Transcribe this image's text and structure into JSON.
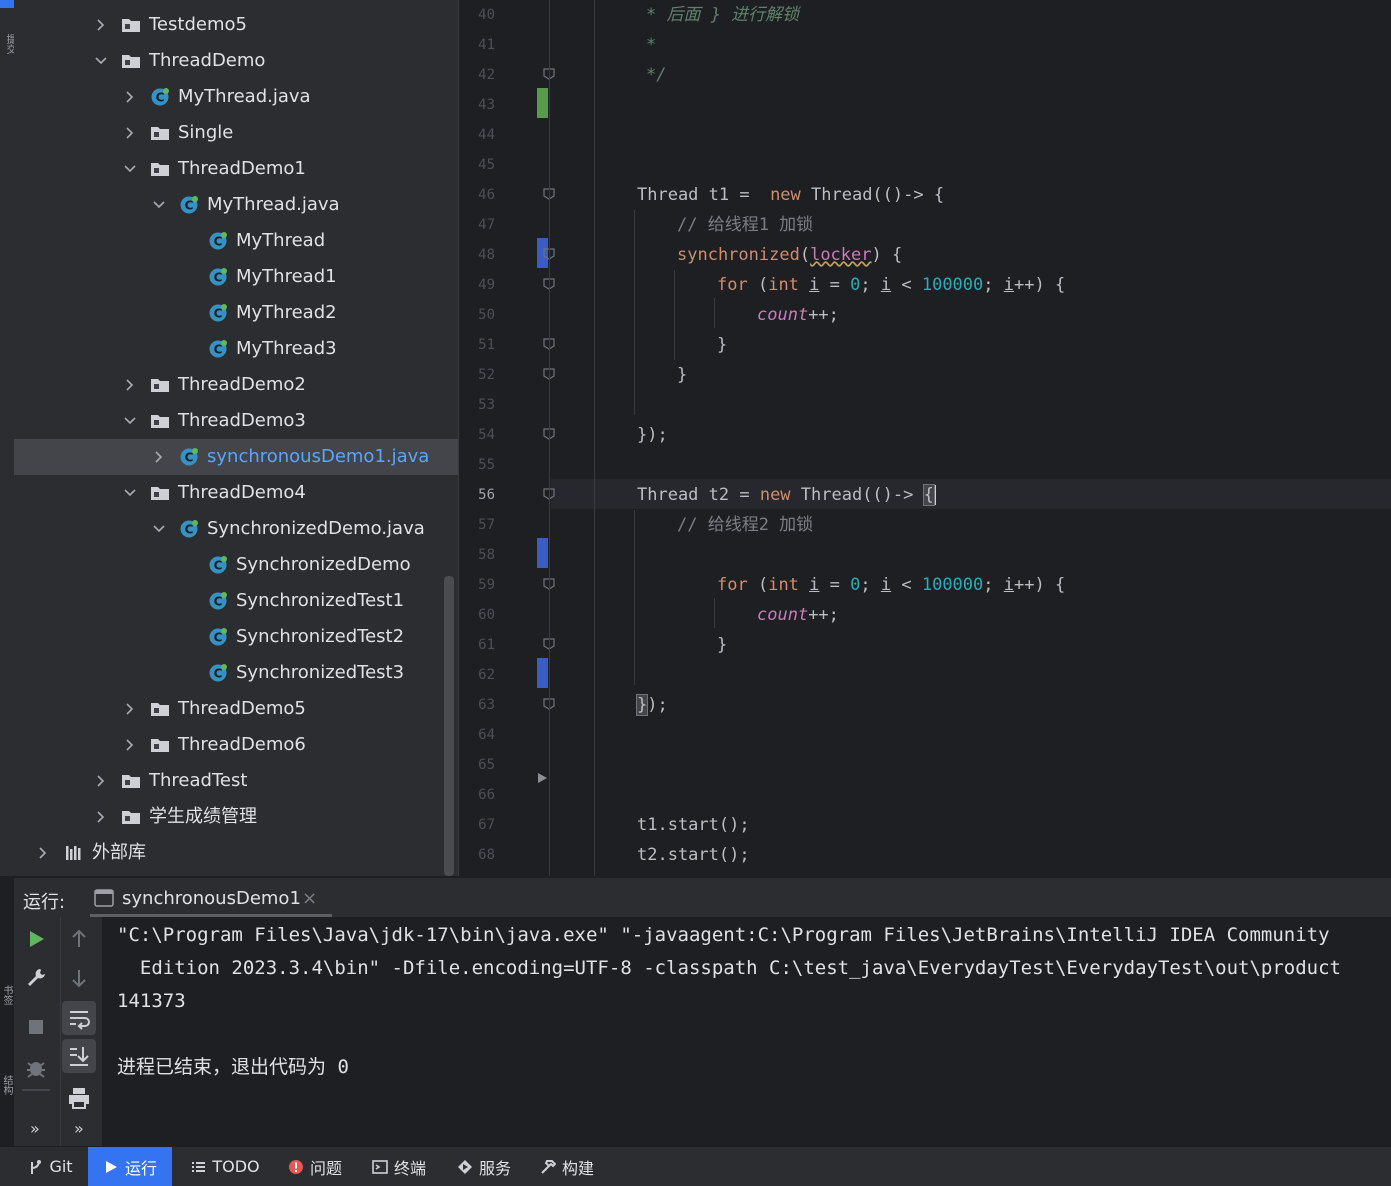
{
  "left_strip": {
    "top_label": "提交",
    "bottom_label_1": "书签",
    "bottom_label_2": "结构"
  },
  "tree": {
    "items": [
      {
        "label": "Testdemo5",
        "indent": 1,
        "expanded": false,
        "icon": "folder-icon"
      },
      {
        "label": "ThreadDemo",
        "indent": 1,
        "expanded": true,
        "icon": "folder-icon"
      },
      {
        "label": "MyThread.java",
        "indent": 2,
        "expanded": false,
        "icon": "class-icon"
      },
      {
        "label": "Single",
        "indent": 2,
        "expanded": false,
        "icon": "folder-icon"
      },
      {
        "label": "ThreadDemo1",
        "indent": 2,
        "expanded": true,
        "icon": "folder-icon"
      },
      {
        "label": "MyThread.java",
        "indent": 3,
        "expanded": true,
        "icon": "class-icon"
      },
      {
        "label": "MyThread",
        "indent": 4,
        "icon": "class-icon"
      },
      {
        "label": "MyThread1",
        "indent": 4,
        "icon": "class-icon"
      },
      {
        "label": "MyThread2",
        "indent": 4,
        "icon": "class-icon"
      },
      {
        "label": "MyThread3",
        "indent": 4,
        "icon": "class-icon"
      },
      {
        "label": "ThreadDemo2",
        "indent": 2,
        "expanded": false,
        "icon": "folder-icon"
      },
      {
        "label": "ThreadDemo3",
        "indent": 2,
        "expanded": true,
        "icon": "folder-icon"
      },
      {
        "label": "synchronousDemo1.java",
        "indent": 3,
        "expanded": false,
        "icon": "class-icon",
        "selected": true
      },
      {
        "label": "ThreadDemo4",
        "indent": 2,
        "expanded": true,
        "icon": "folder-icon"
      },
      {
        "label": "SynchronizedDemo.java",
        "indent": 3,
        "expanded": true,
        "icon": "class-icon"
      },
      {
        "label": "SynchronizedDemo",
        "indent": 4,
        "icon": "class-icon"
      },
      {
        "label": "SynchronizedTest1",
        "indent": 4,
        "icon": "class-icon"
      },
      {
        "label": "SynchronizedTest2",
        "indent": 4,
        "icon": "class-icon"
      },
      {
        "label": "SynchronizedTest3",
        "indent": 4,
        "icon": "class-icon"
      },
      {
        "label": "ThreadDemo5",
        "indent": 2,
        "expanded": false,
        "icon": "folder-icon"
      },
      {
        "label": "ThreadDemo6",
        "indent": 2,
        "expanded": false,
        "icon": "folder-icon"
      },
      {
        "label": "ThreadTest",
        "indent": 1,
        "expanded": false,
        "icon": "folder-icon"
      },
      {
        "label": "学生成绩管理",
        "indent": 1,
        "expanded": false,
        "icon": "folder-icon"
      },
      {
        "label": "外部库",
        "indent": 0,
        "expanded": false,
        "icon": "library-icon"
      }
    ]
  },
  "editor": {
    "line_numbers": [
      "40",
      "41",
      "42",
      "43",
      "44",
      "45",
      "46",
      "47",
      "48",
      "49",
      "50",
      "51",
      "52",
      "53",
      "54",
      "55",
      "56",
      "57",
      "58",
      "59",
      "60",
      "61",
      "62",
      "63",
      "64",
      "65",
      "66",
      "67",
      "68"
    ],
    "current_line": "56",
    "tokens": {
      "l40": "* 后面 } 进行解锁",
      "l41": "*",
      "l42": "*/",
      "l46_a": "Thread t1 =  ",
      "l46_kw": "new",
      "l46_b": " Thread(()-> {",
      "l47": "// 给线程1 加锁",
      "l48_kw": "synchronized",
      "l48_a": "(",
      "l48_locker": "locker",
      "l48_b": ") {",
      "for_kw": "for",
      "for_a": " (",
      "int_kw": "int",
      "sp": " ",
      "i": "i",
      "eq": " = ",
      "zero": "0",
      "semi": "; ",
      "lt": " < ",
      "limit": "100000",
      "inc": "++) {",
      "count": "count",
      "count_tail": "++;",
      "rbrace": "}",
      "close": "});",
      "l56_a": "Thread t2 = ",
      "l56_kw": "new",
      "l56_b": " Thread(()-> ",
      "l56_brace": "{",
      "l57": "// 给线程2 加锁",
      "l63_brace": "}",
      "l63_tail": ");",
      "l67": "t1.start();",
      "l68": "t2.start();"
    }
  },
  "run": {
    "label": "运行:",
    "tab": "synchronousDemo1",
    "close_glyph": "×",
    "output": [
      "\"C:\\Program Files\\Java\\jdk-17\\bin\\java.exe\" \"-javaagent:C:\\Program Files\\JetBrains\\IntelliJ IDEA Community",
      "  Edition 2023.3.4\\bin\" -Dfile.encoding=UTF-8 -classpath C:\\test_java\\EverydayTest\\EverydayTest\\out\\product",
      "141373",
      "",
      "进程已结束，退出代码为 0"
    ],
    "more_glyph": "»"
  },
  "statusbar": {
    "items": [
      {
        "label": "Git",
        "icon": "git-branch-icon"
      },
      {
        "label": "运行",
        "icon": "run-icon",
        "active": true
      },
      {
        "label": "TODO",
        "icon": "todo-list-icon"
      },
      {
        "label": "问题",
        "icon": "problems-icon"
      },
      {
        "label": "终端",
        "icon": "terminal-icon"
      },
      {
        "label": "服务",
        "icon": "services-icon"
      },
      {
        "label": "构建",
        "icon": "build-hammer-icon"
      }
    ]
  },
  "colors": {
    "accent": "#3574f0",
    "keyword": "#cf8e6d",
    "number": "#2aacb8",
    "field": "#c77dbb",
    "vcs_added": "#5a9a4c",
    "vcs_modified": "#3b5cc5"
  }
}
